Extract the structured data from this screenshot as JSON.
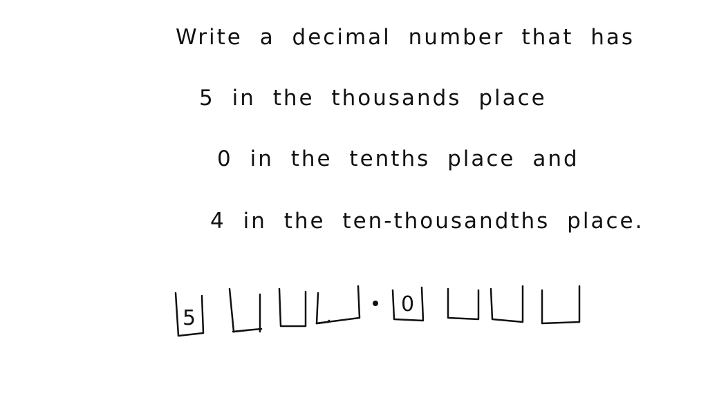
{
  "problem": {
    "lines": [
      "Write a decimal number that has",
      "5 in the thousands place",
      "0 in the tenths place and",
      "4 in the ten-thousandths place."
    ]
  },
  "place_value_boxes": {
    "whole_part": [
      "5",
      "",
      "",
      ""
    ],
    "decimal_point": "•",
    "fractional_part": [
      "0",
      "",
      "",
      ""
    ]
  }
}
